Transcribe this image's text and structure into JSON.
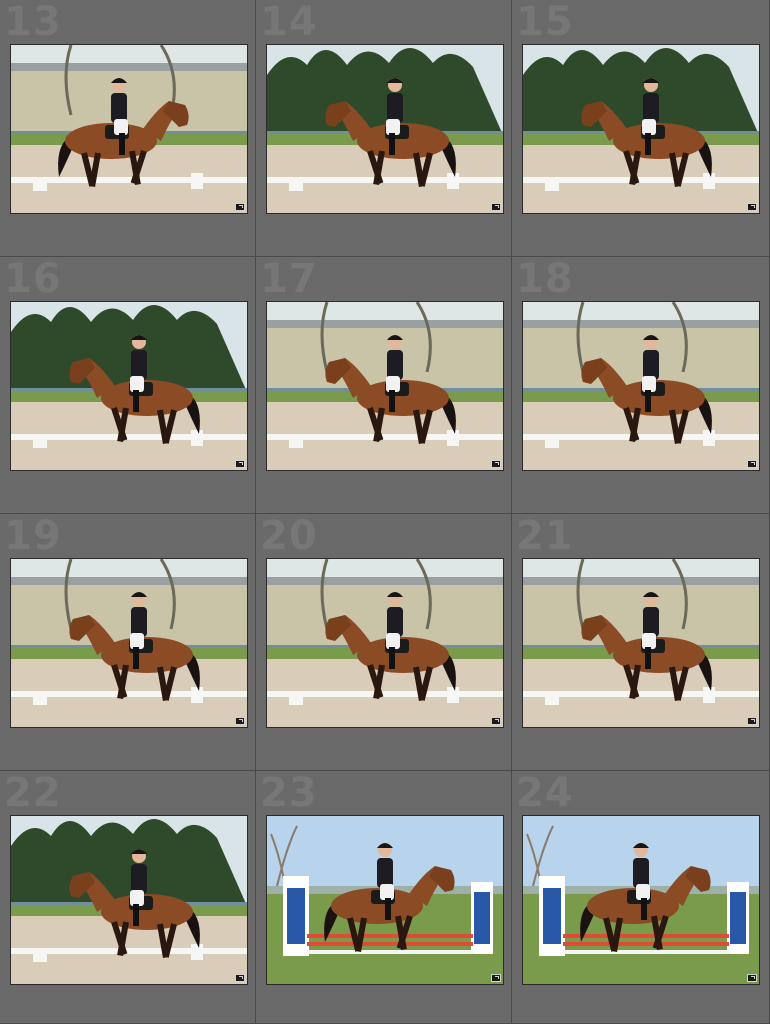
{
  "grid": {
    "cells": [
      {
        "index": "13",
        "scene": "dressage",
        "dir": "right",
        "bg": "barn"
      },
      {
        "index": "14",
        "scene": "dressage",
        "dir": "left",
        "bg": "trees"
      },
      {
        "index": "15",
        "scene": "dressage",
        "dir": "left",
        "bg": "trees"
      },
      {
        "index": "16",
        "scene": "dressage",
        "dir": "left",
        "bg": "trees"
      },
      {
        "index": "17",
        "scene": "dressage",
        "dir": "left",
        "bg": "barn"
      },
      {
        "index": "18",
        "scene": "dressage",
        "dir": "left",
        "bg": "barn"
      },
      {
        "index": "19",
        "scene": "dressage",
        "dir": "left",
        "bg": "barn"
      },
      {
        "index": "20",
        "scene": "dressage",
        "dir": "left",
        "bg": "barn"
      },
      {
        "index": "21",
        "scene": "dressage",
        "dir": "left",
        "bg": "barn"
      },
      {
        "index": "22",
        "scene": "dressage",
        "dir": "left",
        "bg": "trees"
      },
      {
        "index": "23",
        "scene": "jump",
        "dir": "right",
        "bg": "sky"
      },
      {
        "index": "24",
        "scene": "jump",
        "dir": "right",
        "bg": "sky"
      }
    ]
  },
  "colors": {
    "arena_sand": "#d9cdb9",
    "grass": "#7a9a4c",
    "tree_dark": "#2f4a2a",
    "barn": "#c9c3a8",
    "sky": "#b8d4ec",
    "horse_bay": "#8b4b24",
    "jacket": "#1c1c22"
  },
  "icons": {
    "badge": "quick-edit-badge-icon"
  }
}
